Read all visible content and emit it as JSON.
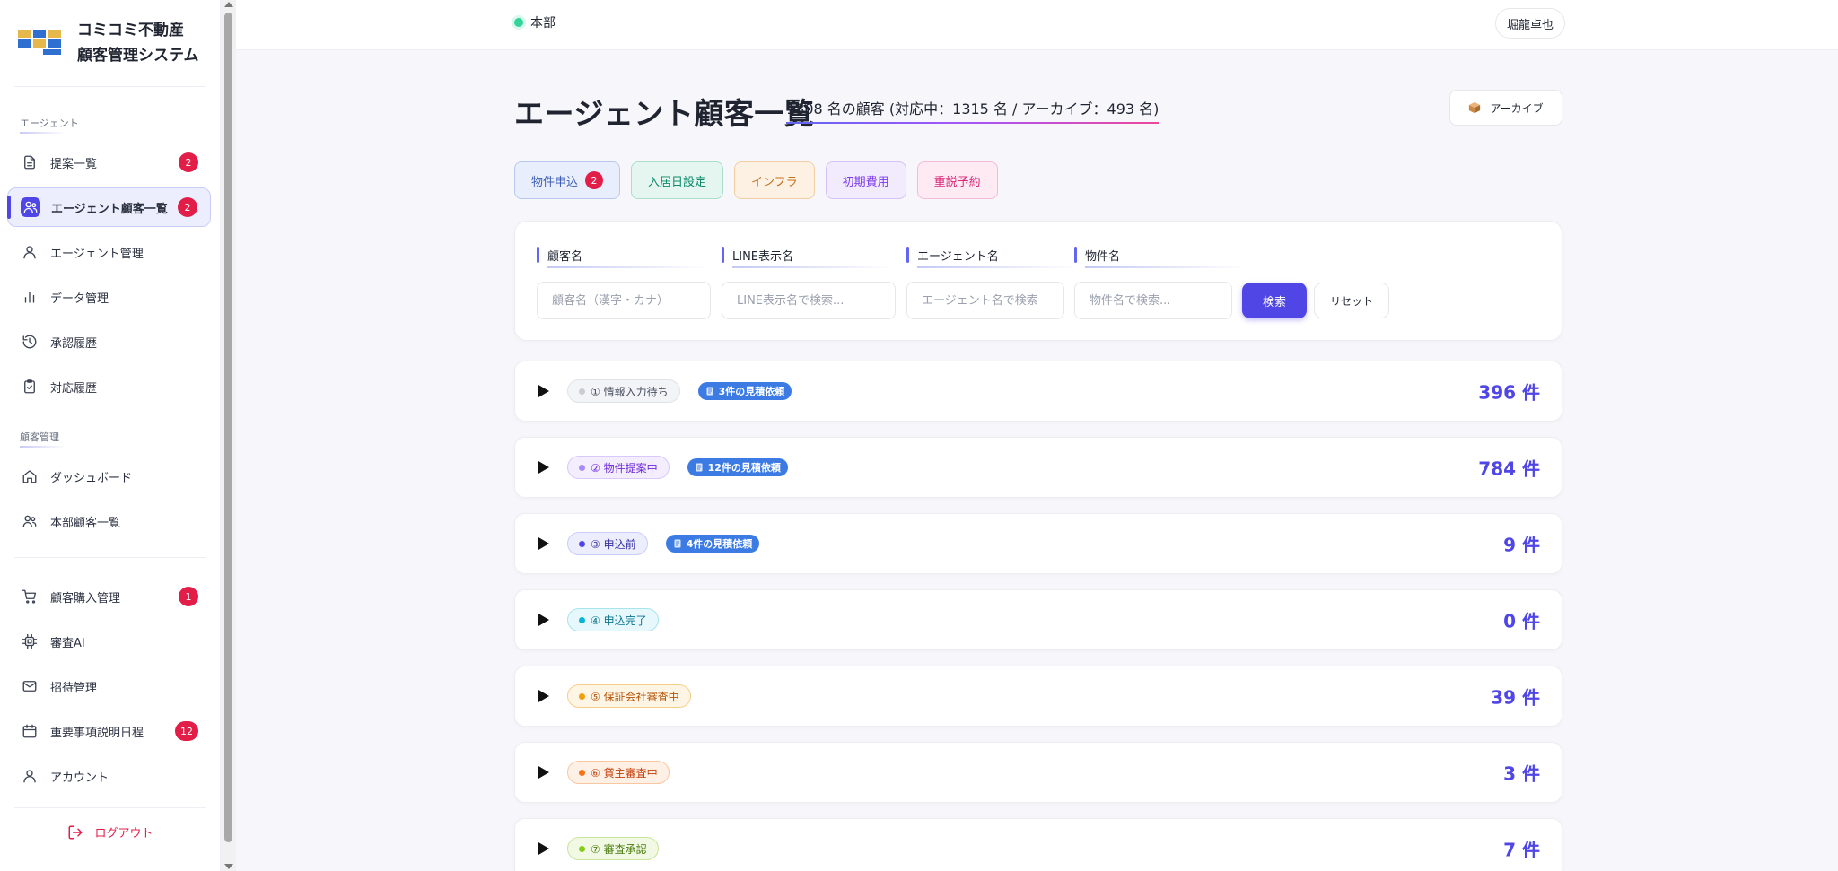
{
  "brand": {
    "line1": "コミコミ不動産",
    "line2": "顧客管理システム",
    "logo_colors": [
      "#e6b84c",
      "#2f6fcf",
      "#e6b84c"
    ]
  },
  "sidebar": {
    "section_agent": "エージェント",
    "agent_items": [
      {
        "label": "提案一覧",
        "icon": "document-icon",
        "badge": "2"
      },
      {
        "label": "エージェント顧客一覧",
        "icon": "users-icon",
        "badge": "2",
        "active": true
      },
      {
        "label": "エージェント管理",
        "icon": "user-icon",
        "badge": ""
      },
      {
        "label": "データ管理",
        "icon": "bar-chart-icon",
        "badge": ""
      },
      {
        "label": "承認履歴",
        "icon": "history-icon",
        "badge": ""
      },
      {
        "label": "対応履歴",
        "icon": "clipboard-check-icon",
        "badge": ""
      }
    ],
    "section_customer": "顧客管理",
    "customer_items": [
      {
        "label": "ダッシュボード",
        "icon": "home-icon",
        "badge": ""
      },
      {
        "label": "本部顧客一覧",
        "icon": "users-icon",
        "badge": ""
      }
    ],
    "other_items": [
      {
        "label": "顧客購入管理",
        "icon": "cart-icon",
        "badge": "1"
      },
      {
        "label": "審査AI",
        "icon": "cpu-icon",
        "badge": ""
      },
      {
        "label": "招待管理",
        "icon": "mail-icon",
        "badge": ""
      },
      {
        "label": "重要事項説明日程",
        "icon": "calendar-icon",
        "badge": "12"
      },
      {
        "label": "アカウント",
        "icon": "user-icon",
        "badge": ""
      }
    ],
    "logout": "ログアウト"
  },
  "topbar": {
    "branch": "本部",
    "user": "堀龍卓也"
  },
  "main": {
    "title": "エージェント顧客一覧",
    "summary": "1808 名の顧客 (対応中：1315 名 / アーカイブ：493 名)",
    "archive_label": "アーカイブ",
    "filters": [
      {
        "label": "物件申込",
        "badge": "2",
        "color": "#3b5bb5",
        "bg": "#e8eefb",
        "border": "#b9c8ee"
      },
      {
        "label": "入居日設定",
        "badge": "",
        "color": "#0f8a6a",
        "bg": "#e5f6f0",
        "border": "#a9dfcc"
      },
      {
        "label": "インフラ",
        "badge": "",
        "color": "#c2701a",
        "bg": "#fdf1e4",
        "border": "#f2cda4"
      },
      {
        "label": "初期費用",
        "badge": "",
        "color": "#7c3aed",
        "bg": "#f1ebfd",
        "border": "#d4c2f7"
      },
      {
        "label": "重説予約",
        "badge": "",
        "color": "#db2777",
        "bg": "#fdeaf3",
        "border": "#f4bcd6"
      }
    ],
    "search": {
      "fields": [
        {
          "label": "顧客名",
          "placeholder": "顧客名（漢字・カナ）"
        },
        {
          "label": "LINE表示名",
          "placeholder": "LINE表示名で検索..."
        },
        {
          "label": "エージェント名",
          "placeholder": "エージェント名で検索"
        },
        {
          "label": "物件名",
          "placeholder": "物件名で検索..."
        }
      ],
      "search_label": "検索",
      "reset_label": "リセット"
    },
    "statuses": [
      {
        "label": "① 情報入力待ち",
        "quote": "3件の見積依頼",
        "count": "396 件",
        "dot": "#c9ccd4",
        "text": "#4b5160",
        "bg": "#f3f4f7",
        "border": "#e1e3e9"
      },
      {
        "label": "② 物件提案中",
        "quote": "12件の見積依頼",
        "count": "784 件",
        "dot": "#a78bfa",
        "text": "#6d28d9",
        "bg": "#f3edfe",
        "border": "#d9c9fa"
      },
      {
        "label": "③ 申込前",
        "quote": "4件の見積依頼",
        "count": "9 件",
        "dot": "#4f46e5",
        "text": "#3730a3",
        "bg": "#eceefe",
        "border": "#c9cdf7"
      },
      {
        "label": "④ 申込完了",
        "quote": "",
        "count": "0 件",
        "dot": "#06b6d4",
        "text": "#0e7490",
        "bg": "#e6f8fb",
        "border": "#a7e4ee"
      },
      {
        "label": "⑤ 保証会社審査中",
        "quote": "",
        "count": "39 件",
        "dot": "#f59e0b",
        "text": "#b45309",
        "bg": "#fef5e4",
        "border": "#f4cf88"
      },
      {
        "label": "⑥ 貸主審査中",
        "quote": "",
        "count": "3 件",
        "dot": "#f97316",
        "text": "#c2410c",
        "bg": "#fff0e6",
        "border": "#f8c7a2"
      },
      {
        "label": "⑦ 審査承認",
        "quote": "",
        "count": "7 件",
        "dot": "#84cc16",
        "text": "#4d7c0f",
        "bg": "#f1f9e4",
        "border": "#c8e59a"
      }
    ],
    "accent": "#4f46e5"
  }
}
